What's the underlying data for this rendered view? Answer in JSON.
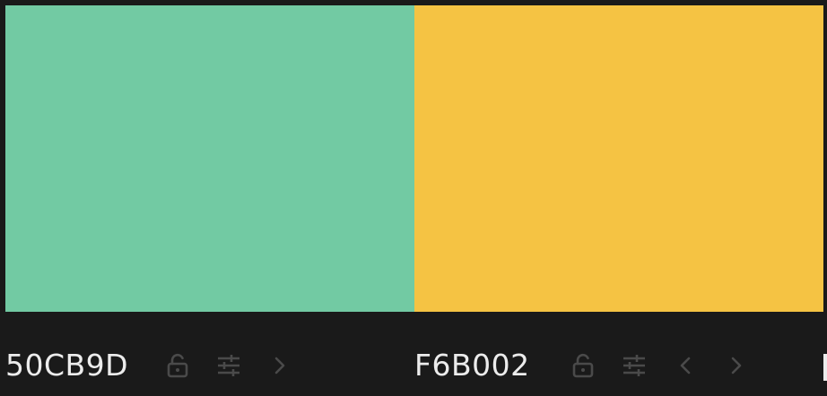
{
  "palette": {
    "swatches": [
      {
        "hex": "50CB9D",
        "color": "#72CAA3"
      },
      {
        "hex": "F6B002",
        "color": "#F5C343"
      }
    ]
  },
  "icons": {
    "lock": "unlock-icon",
    "adjust": "sliders-icon",
    "prev": "chevron-left-icon",
    "next": "chevron-right-icon"
  },
  "colors": {
    "background": "#1A1A1A",
    "text": "#ECECEC",
    "icon": "#4A4A4A"
  }
}
